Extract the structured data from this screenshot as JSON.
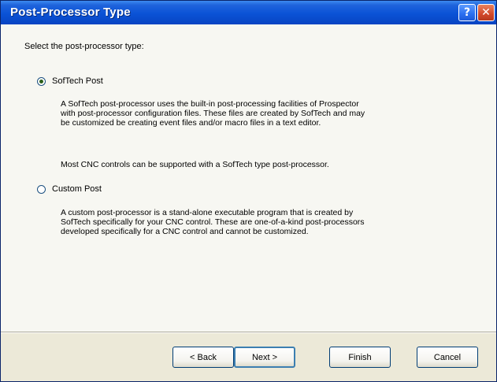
{
  "window": {
    "title": "Post-Processor Type",
    "help_glyph": "?",
    "close_glyph": "✕"
  },
  "prompt": "Select the post-processor type:",
  "options": [
    {
      "label": "SofTech Post",
      "selected": true,
      "description_lines": [
        "A SofTech post-processor uses the built-in post-processing facilities of Prospector",
        "with post-processor configuration files.  These files are created by SofTech and may",
        "be customized be creating event files and/or macro files in a text editor."
      ],
      "note": "Most CNC controls can be supported with a SofTech type post-processor."
    },
    {
      "label": "Custom Post",
      "selected": false,
      "description_lines": [
        "A custom post-processor is a stand-alone executable program that is created by",
        "SofTech specifically for your CNC control.  These are one-of-a-kind post-processors",
        "developed specifically for a CNC control and cannot be customized."
      ]
    }
  ],
  "buttons": {
    "back": "< Back",
    "next": "Next >",
    "finish": "Finish",
    "cancel": "Cancel"
  }
}
